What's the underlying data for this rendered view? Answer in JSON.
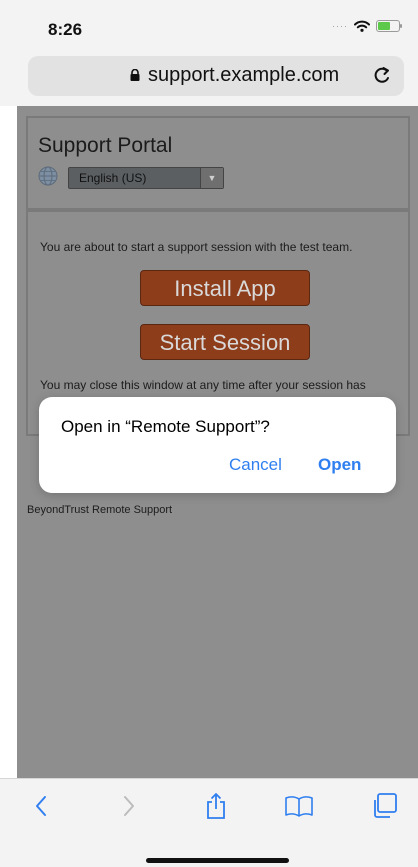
{
  "status_bar": {
    "time": "8:26",
    "signal_icon": "cellular-dots-icon",
    "wifi_icon": "wifi-icon",
    "battery_icon": "battery-charging-icon"
  },
  "browser": {
    "url": "support.example.com",
    "lock_icon": "lock-icon",
    "reload_icon": "reload-icon"
  },
  "page": {
    "title": "Support Portal",
    "language": {
      "selected": "English (US)",
      "globe_icon": "globe-icon"
    },
    "intro_text": "You are about to start a support session with the test team.",
    "install_button": "Install App",
    "start_button": "Start Session",
    "closing_text": "You may close this window at any time after your session has",
    "footer_text": "BeyondTrust Remote Support"
  },
  "dialog": {
    "message": "Open in “Remote Support”?",
    "cancel_label": "Cancel",
    "open_label": "Open"
  },
  "toolbar": {
    "items": [
      "back-icon",
      "forward-icon",
      "share-icon",
      "bookmarks-icon",
      "tabs-icon"
    ]
  },
  "colors": {
    "accent": "#2f7ff0",
    "web_button": "#8e3d1b",
    "overlay_page": "#8e8e8e"
  }
}
